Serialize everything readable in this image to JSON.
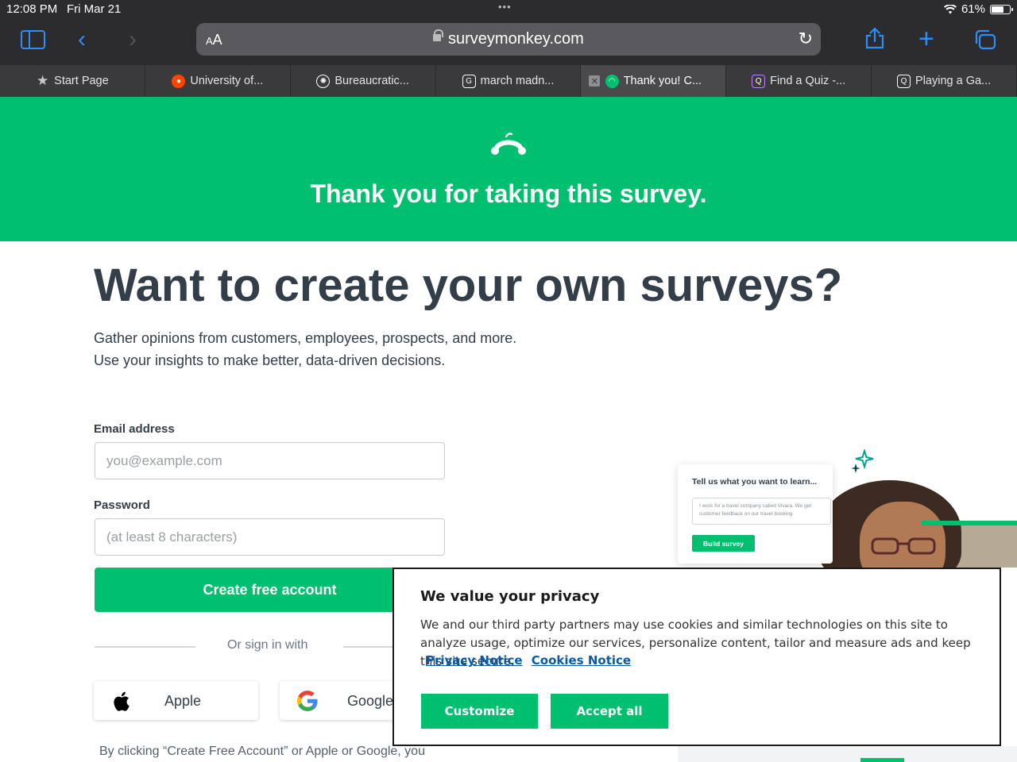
{
  "status_bar": {
    "time": "12:08 PM",
    "date": "Fri Mar 21",
    "battery": "61%",
    "battery_level": 0.61,
    "wifi_icon": "wifi-icon"
  },
  "toolbar": {
    "text_size_label": "AA",
    "url": "surveymonkey.com",
    "accent_color": "#2f8ef5"
  },
  "tabs": [
    {
      "label": "Start Page",
      "icon": "star-icon"
    },
    {
      "label": "University of...",
      "icon": "reddit-icon"
    },
    {
      "label": "Bureaucratic...",
      "icon": "openai-icon"
    },
    {
      "label": "march madn...",
      "icon": "g-icon"
    },
    {
      "label": "Thank you! C...",
      "icon": "surveymonkey-icon",
      "active": true
    },
    {
      "label": "Find a Quiz -...",
      "icon": "quiz-icon"
    },
    {
      "label": "Playing a Ga...",
      "icon": "q-icon"
    }
  ],
  "banner": {
    "title": "Thank you for taking this survey.",
    "color": "#00bf6f"
  },
  "main": {
    "headline": "Want to create your own surveys?",
    "sub_line1": "Gather opinions from customers, employees, prospects, and more.",
    "sub_line2": "Use your insights to make better, data-driven decisions."
  },
  "form": {
    "email_label": "Email address",
    "email_placeholder": "you@example.com",
    "password_label": "Password",
    "password_placeholder": "(at least 8 characters)",
    "submit_label": "Create free account",
    "or_label": "Or sign in with",
    "apple_label": "Apple",
    "google_label": "Google",
    "legal_text": "By clicking “Create Free Account” or Apple or Google, you"
  },
  "promo": {
    "card_title": "Tell us what you want to learn...",
    "card_input": "I work for a travel company called Vivara. We get customer feedback on our travel booking",
    "card_button": "Build survey"
  },
  "privacy": {
    "title": "We value your privacy",
    "body": "We and our third party partners may use cookies and similar technologies on this site to analyze usage, optimize our services, personalize content, tailor and measure ads and keep this site secure.",
    "privacy_link": "Privacy Notice",
    "cookies_link": "Cookies Notice",
    "customize_label": "Customize",
    "accept_label": "Accept all"
  }
}
